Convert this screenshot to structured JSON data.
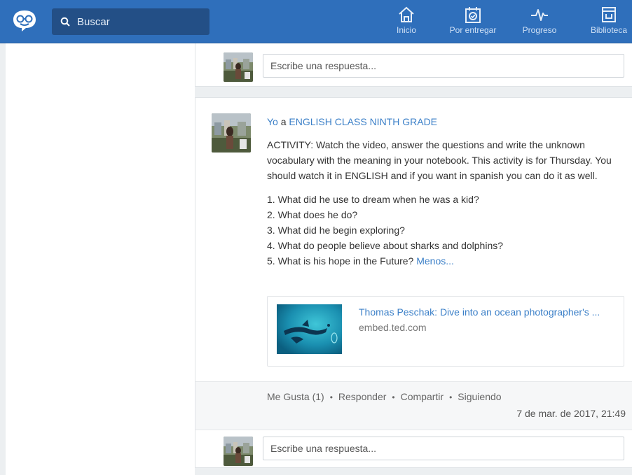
{
  "search": {
    "placeholder": "Buscar"
  },
  "nav": [
    {
      "label": "Inicio",
      "icon": "home-icon"
    },
    {
      "label": "Por entregar",
      "icon": "calendar-check-icon"
    },
    {
      "label": "Progreso",
      "icon": "pulse-icon"
    },
    {
      "label": "Biblioteca",
      "icon": "library-icon"
    }
  ],
  "reply_top": {
    "placeholder": "Escribe una respuesta..."
  },
  "post": {
    "author": "Yo",
    "connector": " a ",
    "group": "ENGLISH CLASS NINTH GRADE",
    "activity": "ACTIVITY: Watch the video, answer the questions and write the unknown vocabulary with the meaning in your notebook. This activity is for Thursday. You should watch it in ENGLISH and if you want in spanish you can do it as well.",
    "questions": [
      "1. What did he use to dream when he was a kid?",
      "2. What does he do?",
      "3. What did he begin exploring?",
      "4. What do people believe about sharks and dolphins?",
      "5. What is his hope in the Future?"
    ],
    "less_link": "Menos...",
    "attachment": {
      "title": "Thomas Peschak: Dive into an ocean photographer's ...",
      "domain": "embed.ted.com"
    },
    "actions": {
      "like": "Me Gusta (1)",
      "reply": "Responder",
      "share": "Compartir",
      "follow": "Siguiendo",
      "separator": "•"
    },
    "timestamp": "7 de mar. de 2017, 21:49"
  },
  "reply_bottom": {
    "placeholder": "Escribe una respuesta..."
  },
  "colors": {
    "brand": "#2f6fbb",
    "link": "#3c80c8",
    "background": "#eceff1"
  }
}
